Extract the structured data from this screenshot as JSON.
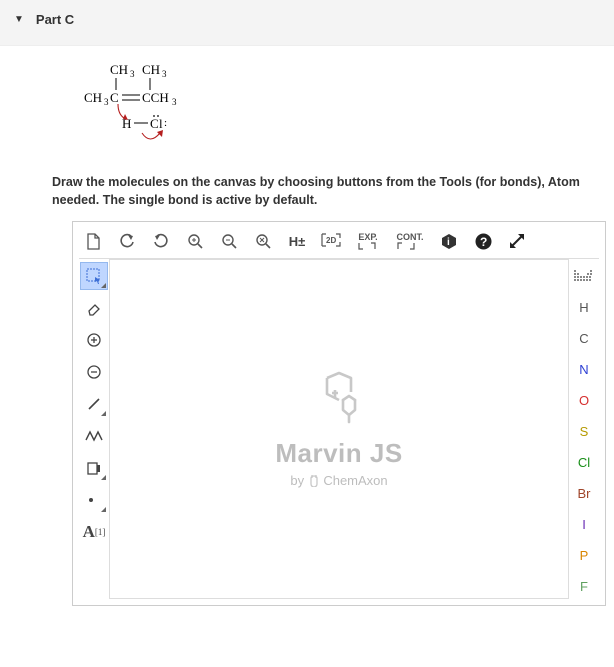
{
  "header": {
    "title": "Part C"
  },
  "instructions": "Draw the molecules on the canvas by choosing buttons from the Tools (for bonds), Atom needed. The single bond is active by default.",
  "molecule": {
    "top_left": "CH₃",
    "top_right": "CH₃",
    "mid_left": "CH₃C",
    "mid_right": "CCH₃",
    "bottom_left": "H",
    "bottom_right": "C̈l:"
  },
  "top_toolbar": {
    "hpm": "H±",
    "view2d": "2D",
    "expand": "EXP.",
    "contract": "CONT."
  },
  "left_tools": {
    "abbrev": "A",
    "abbrev_sup": "[1]"
  },
  "canvas": {
    "logo_main": "Marvin JS",
    "byline_pre": "by",
    "byline_post": "ChemAxon"
  },
  "atoms": {
    "H": {
      "label": "H",
      "color": "#555555"
    },
    "C": {
      "label": "C",
      "color": "#555555"
    },
    "N": {
      "label": "N",
      "color": "#2d3fd4"
    },
    "O": {
      "label": "O",
      "color": "#d62f2f"
    },
    "S": {
      "label": "S",
      "color": "#b59a00"
    },
    "Cl": {
      "label": "Cl",
      "color": "#1a8f1a"
    },
    "Br": {
      "label": "Br",
      "color": "#a0452a"
    },
    "I": {
      "label": "I",
      "color": "#6b2fb5"
    },
    "P": {
      "label": "P",
      "color": "#d98500"
    },
    "F": {
      "label": "F",
      "color": "#5fa05f"
    }
  }
}
